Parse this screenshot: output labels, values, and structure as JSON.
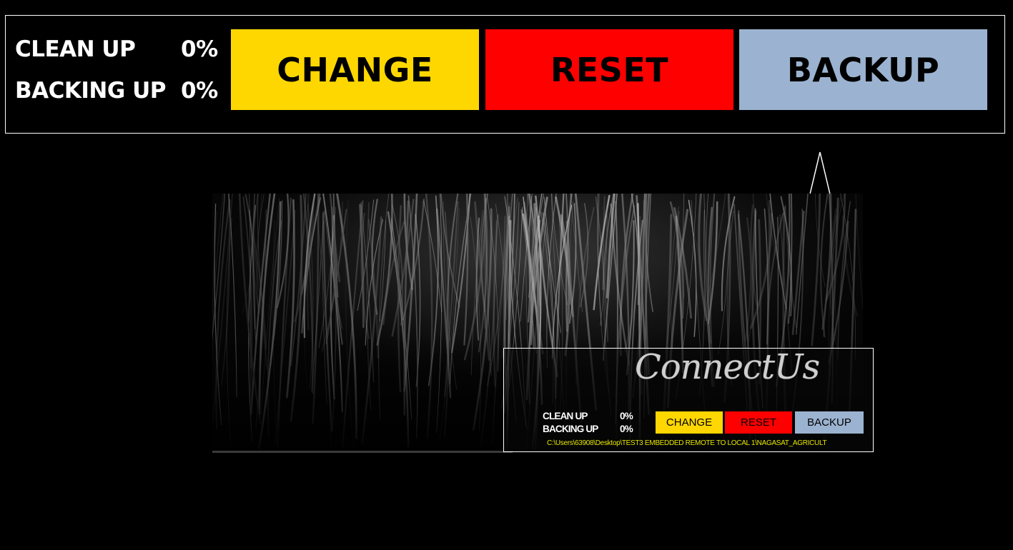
{
  "zoom_panel": {
    "clean_up_label": "CLEAN UP",
    "clean_up_value": "0%",
    "backing_up_label": "BACKING UP",
    "backing_up_value": "0%",
    "buttons": {
      "change": "CHANGE",
      "reset": "RESET",
      "backup": "BACKUP"
    }
  },
  "widget": {
    "logo_text": "ConnectUs",
    "clean_up_label": "CLEAN UP",
    "clean_up_value": "0%",
    "backing_up_label": "BACKING UP",
    "backing_up_value": "0%",
    "buttons": {
      "change": "CHANGE",
      "reset": "RESET",
      "backup": "BACKUP"
    },
    "path": "C:\\Users\\63908\\Desktop\\TEST3 EMBEDDED REMOTE TO LOCAL 1\\NAGASAT_AGRICULT"
  },
  "colors": {
    "background": "#000000",
    "change": "#FFD700",
    "reset": "#FF0000",
    "backup": "#9BB3D0",
    "path_text": "#E6E600",
    "border": "#FFFFFF"
  },
  "icons": {
    "arrow": "up-arrow-icon",
    "background_picture": "hair-texture-image"
  }
}
